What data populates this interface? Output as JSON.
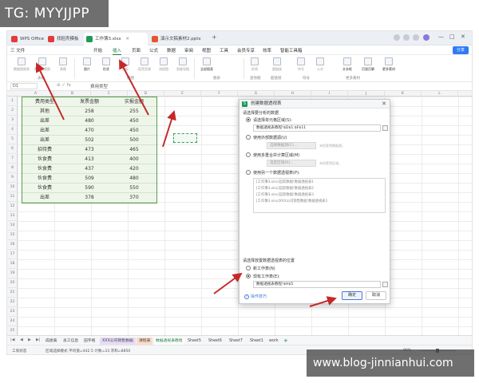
{
  "watermarks": {
    "top_left": "TG: MYYJJPP",
    "bottom_right": "www.blog-jinnianhui.com"
  },
  "tabs": [
    {
      "label": "WPS Office",
      "color": "#e23b3b"
    },
    {
      "label": "找稻壳模板",
      "color": "#e23b3b"
    },
    {
      "label": "工作簿3.xlsx",
      "color": "#1d9a57"
    },
    {
      "label": "演示文稿素材2.pptx",
      "color": "#e4572e"
    }
  ],
  "tab_add": "+",
  "window_controls": [
    "—",
    "□",
    "✕"
  ],
  "menu": [
    "三 文件",
    "开始",
    "插入",
    "页面",
    "公式",
    "数据",
    "审阅",
    "视图",
    "工具",
    "会员专享",
    "效率",
    "智能工具箱"
  ],
  "menu_active_index": 2,
  "share_label": "分享",
  "ribbon": {
    "buttons": [
      "数据透视表",
      "数据透视图",
      "表格",
      "图片",
      "形状",
      "图标",
      "稻壳资源",
      "流程图",
      "思维导图",
      "全部图表",
      "折线",
      "柱形",
      "盈亏",
      "文本框",
      "页眉页脚",
      "艺术字",
      "附件",
      "符号",
      "公式",
      "超链接",
      "更多素材"
    ],
    "groups": [
      "表格",
      "插图",
      "图表",
      "迷你图",
      "超链接",
      "符号",
      "更多素材"
    ]
  },
  "formula": {
    "namebox": "D1",
    "fx": "⊘ ✓ fx",
    "value": "费用类型"
  },
  "columns": [
    "A",
    "B",
    "C",
    "D",
    "E",
    "F",
    "G",
    "H",
    "I",
    "J",
    "K",
    "L",
    "M",
    "N"
  ],
  "rows": [
    "1",
    "2",
    "3",
    "4",
    "5",
    "6",
    "7",
    "8",
    "9",
    "10",
    "11",
    "12",
    "13",
    "14",
    "15",
    "16",
    "17",
    "18",
    "19",
    "20",
    "21",
    "22",
    "23",
    "24",
    "25"
  ],
  "table": {
    "headers": [
      "费用类型",
      "发票金额",
      "实报金额"
    ],
    "rows": [
      [
        "其他",
        "258",
        "255"
      ],
      [
        "出差",
        "480",
        "450"
      ],
      [
        "出差",
        "470",
        "450"
      ],
      [
        "出差",
        "502",
        "500"
      ],
      [
        "招待费",
        "473",
        "465"
      ],
      [
        "伙食费",
        "413",
        "400"
      ],
      [
        "伙食费",
        "437",
        "420"
      ],
      [
        "伙食费",
        "509",
        "480"
      ],
      [
        "伙食费",
        "590",
        "550"
      ],
      [
        "出差",
        "378",
        "370"
      ]
    ]
  },
  "dialog": {
    "title": "创建数据透视表",
    "section1": "请选择要分析的数据",
    "opt_select_range": "请选择单元格区域(S):",
    "range_value": "数据透视表教程!$D$1:$F$11",
    "opt_external": "使用外部数据源(U)",
    "choose_data_btn": "选择数据源(C)...",
    "no_data_hint": "未检索到数据源。",
    "opt_multi": "使用多重合并计算区域(M)",
    "choose_area_btn": "选定区域(R)...",
    "no_area_hint": "未检索到区域。",
    "opt_other_pivot": "使用另一个数据透视表(P):",
    "pivot_list": [
      "[工作簿3.xlsx]追踪数据!数据透视表1",
      "[工作簿3.xlsx]追踪数据!数据透视表2",
      "[工作簿3.xlsx]追踪数据!数据透视表3",
      "[工作簿3.xlsx]XXX公司销售数据!数据透视表1"
    ],
    "section2": "请选择放置数据透视表的位置",
    "opt_new_sheet": "新工作表(N)",
    "opt_existing_sheet": "现有工作表(E):",
    "location_value": "数据透视表教程!$H$5",
    "tip": "操作技巧",
    "ok": "确定",
    "cancel": "取消"
  },
  "sheet_tabs": [
    "成绩表",
    "员工信息",
    "田字格",
    "XXX公司销售数据",
    "课程表",
    "数据透视表教程",
    "Sheet5",
    "Sheet6",
    "Sheet7",
    "Sheet1",
    "work"
  ],
  "sheet_active_index": 5,
  "status": {
    "mode": "工资状态",
    "stats": "区域选择模式 平均值=442.5 计数=33 求和=8850",
    "zoom": "90%"
  },
  "accent_color": "#1f7a43"
}
